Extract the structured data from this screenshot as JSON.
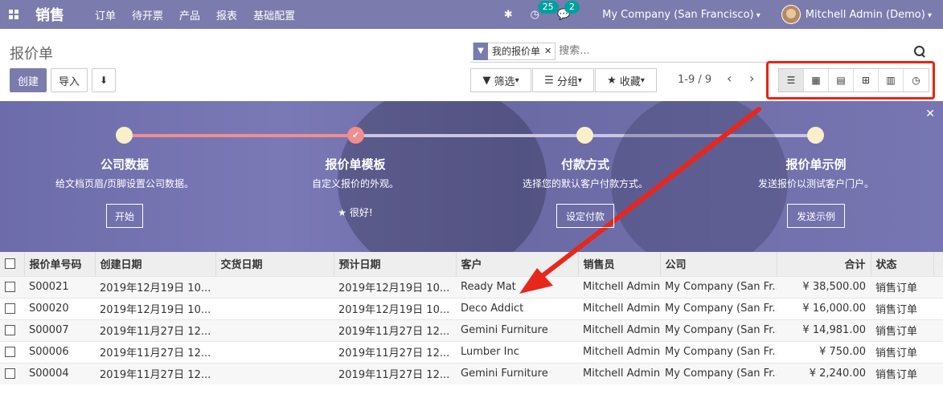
{
  "navbar": {
    "brand": "销售",
    "menu": [
      "订单",
      "待开票",
      "产品",
      "报表",
      "基础配置"
    ],
    "activity_count": "25",
    "message_count": "2",
    "company": "My Company (San Francisco)",
    "user": "Mitchell Admin (Demo)"
  },
  "control": {
    "title": "报价单",
    "create": "创建",
    "import": "导入",
    "facet": "我的报价单",
    "search_placeholder": "搜索...",
    "filter": "筛选",
    "group": "分组",
    "favorite": "收藏",
    "pager": "1-9 / 9",
    "views": [
      "list",
      "kanban",
      "calendar",
      "pivot",
      "graph",
      "activity"
    ]
  },
  "banner": {
    "steps": [
      {
        "title": "公司数据",
        "desc": "给文档页眉/页脚设置公司数据。",
        "button": "开始",
        "done": false
      },
      {
        "title": "报价单模板",
        "desc": "自定义报价的外观。",
        "done_text": "★ 很好!",
        "done": true
      },
      {
        "title": "付款方式",
        "desc": "选择您的默认客户付款方式。",
        "button": "设定付款",
        "done": false
      },
      {
        "title": "报价单示例",
        "desc": "发送报价以测试客户门户。",
        "button": "发送示例",
        "done": false
      }
    ]
  },
  "table": {
    "columns": [
      "报价单号码",
      "创建日期",
      "交货日期",
      "预计日期",
      "客户",
      "销售员",
      "公司",
      "合计",
      "状态"
    ],
    "rows": [
      [
        "S00021",
        "2019年12月19日 10...",
        "",
        "2019年12月19日 10...",
        "Ready Mat",
        "Mitchell Admin",
        "My Company (San Fr...",
        "¥ 38,500.00",
        "销售订单"
      ],
      [
        "S00020",
        "2019年12月19日 10...",
        "",
        "2019年12月19日 10...",
        "Deco Addict",
        "Mitchell Admin",
        "My Company (San Fr...",
        "¥ 16,000.00",
        "销售订单"
      ],
      [
        "S00007",
        "2019年11月27日 12...",
        "",
        "2019年11月27日 12...",
        "Gemini Furniture",
        "Mitchell Admin",
        "My Company (San Fr...",
        "¥ 14,981.00",
        "销售订单"
      ],
      [
        "S00006",
        "2019年11月27日 12...",
        "",
        "2019年11月27日 12...",
        "Lumber Inc",
        "Mitchell Admin",
        "My Company (San Fr...",
        "¥ 750.00",
        "销售订单"
      ],
      [
        "S00004",
        "2019年11月27日 12...",
        "",
        "2019年11月27日 12...",
        "Gemini Furniture",
        "Mitchell Admin",
        "My Company (San Fr...",
        "¥ 2,240.00",
        "销售订单"
      ]
    ]
  }
}
